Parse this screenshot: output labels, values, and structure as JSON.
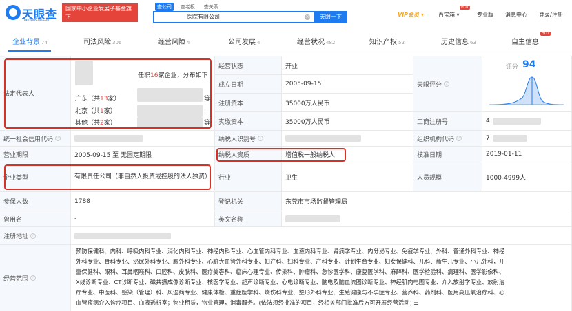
{
  "header": {
    "logo_text": "天眼查",
    "logo_sub": "TianYanCha.com",
    "promo_line1": "国家中小企业发展子基金旗下",
    "promo_line2": "官方备案企业征信机构",
    "search_tabs": [
      "查公司",
      "查老板",
      "查关系"
    ],
    "search_value": "医院有限公司",
    "search_clear": "×",
    "search_button": "天眼一下",
    "vip": "VIP会员",
    "vip_arrow": "▾",
    "baobaoxiang": "百宝箱",
    "hot": "HOT",
    "pro": "专业版",
    "msg": "消息中心",
    "login": "登录/注册"
  },
  "tabs": [
    {
      "label": "企业背景",
      "count": "74"
    },
    {
      "label": "司法风险",
      "count": "306"
    },
    {
      "label": "经营风险",
      "count": "4"
    },
    {
      "label": "公司发展",
      "count": "4"
    },
    {
      "label": "经营状况",
      "count": "482"
    },
    {
      "label": "知识产权",
      "count": "52"
    },
    {
      "label": "历史信息",
      "count": "63"
    },
    {
      "label": "自主信息",
      "count": ""
    }
  ],
  "info": {
    "legal_rep_label": "法定代表人",
    "legal_rep_tenure_pre": "任职",
    "legal_rep_tenure_num": "16",
    "legal_rep_tenure_post": "家企业，分布如下",
    "regions": [
      {
        "name": "广东（共",
        "num": "13",
        "unit": "家）",
        "tail": "等"
      },
      {
        "name": "北京（共",
        "num": "1",
        "unit": "家）",
        "tail": "."
      },
      {
        "name": "其他（共",
        "num": "2",
        "unit": "家）",
        "tail": "等"
      }
    ],
    "status_label": "经营状态",
    "status_value": "开业",
    "founded_label": "成立日期",
    "founded_value": "2005-09-15",
    "capital_label": "注册资本",
    "capital_value": "35000万人民币",
    "paid_label": "实缴资本",
    "paid_value": "35000万人民币",
    "score_label": "天眼评分",
    "score_prefix": "评分",
    "score_value": "94",
    "business_reg_label": "工商注册号",
    "business_reg_value": "4",
    "credit_code_label": "统一社会信用代码",
    "taxpayer_id_label": "纳税人识别号",
    "org_code_label": "组织机构代码",
    "org_code_value": "7",
    "term_label": "营业期限",
    "term_value": "2005-09-15 至 无固定期限",
    "taxpayer_qual_label": "纳税人资质",
    "taxpayer_qual_value": "增值税一般纳税人",
    "approve_label": "核准日期",
    "approve_value": "2019-01-11",
    "type_label": "企业类型",
    "type_value": "有限责任公司（非自然人投资或控股的法人独资）",
    "industry_label": "行业",
    "industry_value": "卫生",
    "staff_label": "人员规模",
    "staff_value": "1000-4999人",
    "insured_label": "参保人数",
    "insured_value": "1788",
    "authority_label": "登记机关",
    "authority_value": "东莞市市场监督管理局",
    "former_label": "曾用名",
    "former_value": "-",
    "english_label": "英文名称",
    "address_label": "注册地址",
    "scope_label": "经营范围",
    "scope_lines": [
      "预防保健科、内科、呼吸内科专业、消化内科专业、神经内科专业、心血管内科专业、血液内科专业、肾病学专业、内分泌专业、免疫学专业、外科、普通外科专业、神经",
      "外科专业、骨科专业、泌尿外科专业、胸外科专业、心脏大血管外科专业、妇产科、妇科专业、产科专业、计划生育专业、妇女保健科、儿科、新生儿专业、小儿外科，儿",
      "童保健科、眼科、耳鼻咽喉科、口腔科、皮肤科、医疗美容科、临床心理专业、传染科、肿瘤科、急诊医学科、康复医学科、麻醉科、医学检验科、病理科、医学影像科、",
      "X线诊断专业、CT诊断专业、磁共振成像诊断专业、核医学专业、超声诊断专业、心电诊断专业、脑电及脑血流图诊断专业、神经肌肉电图专业、介入放射学专业、放射治",
      "疗专业、中医科、感染（管理）科、风湿病专业、健康体检、重症医学科、烧伤科专业、整形外科专业、生殖健康与不孕症专业、营养科、药剂科、医用高压氧治疗科、心",
      "血管疾病介入诊疗项目、血液透析室；物业租赁，物业管理，消毒服务。(依法须经批准的项目，经相关部门批准后方可开展经营活动)"
    ],
    "scope_more": "☰"
  },
  "colors": {
    "accent": "#1e7cf0",
    "highlight": "#d93025",
    "label_bg": "#f5f8fc",
    "red": "#e4443a"
  },
  "icons": [
    "logo-icon",
    "question-icon",
    "clear-icon",
    "score-curve-icon"
  ]
}
